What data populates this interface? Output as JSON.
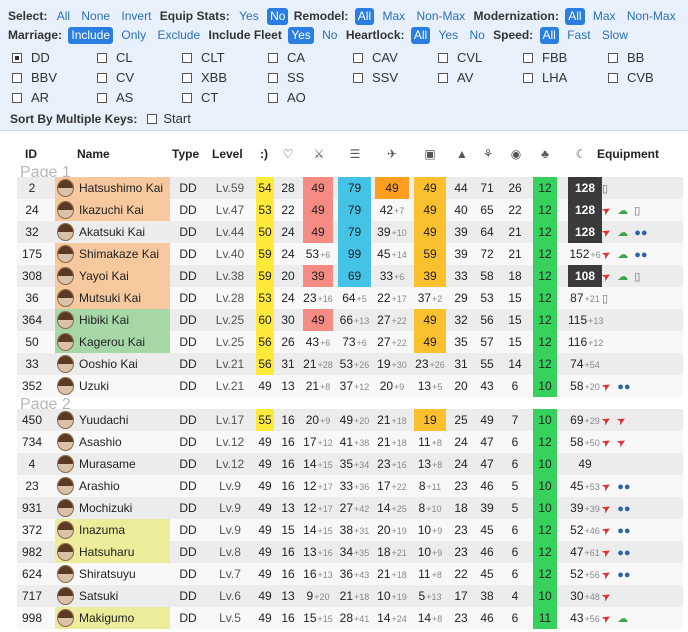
{
  "colors": {
    "yellow": "#ffe93b",
    "salmon": "#f58b83",
    "cyan": "#44c3e6",
    "orange": "#ff9e1f",
    "gold": "#fbc02d",
    "green": "#37d15d",
    "dark": "#3a3a3a",
    "name_orange": "#f6c89d",
    "name_green": "#a7d7a7",
    "name_yellow": "#ecec9a",
    "accent": "#2a7de1"
  },
  "filters": {
    "select": {
      "label": "Select:",
      "options": [
        "All",
        "None",
        "Invert"
      ]
    },
    "equip": {
      "label": "Equip Stats:",
      "options": [
        "Yes",
        "No"
      ],
      "selected": 1
    },
    "remodel": {
      "label": "Remodel:",
      "options": [
        "All",
        "Max",
        "Non-Max"
      ],
      "selected": 0
    },
    "modernization": {
      "label": "Modernization:",
      "options": [
        "All",
        "Max",
        "Non-Max"
      ],
      "selected": 0
    },
    "marriage": {
      "label": "Marriage:",
      "options": [
        "Include",
        "Only",
        "Exclude"
      ],
      "selected": 0
    },
    "fleet": {
      "label": "Include Fleet",
      "options": [
        "Yes",
        "No"
      ],
      "selected": 0
    },
    "heartlock": {
      "label": "Heartlock:",
      "options": [
        "All",
        "Yes",
        "No"
      ],
      "selected": 0
    },
    "speed": {
      "label": "Speed:",
      "options": [
        "All",
        "Fast",
        "Slow"
      ],
      "selected": 0
    }
  },
  "types": [
    {
      "label": "DD",
      "checked": true
    },
    {
      "label": "CL",
      "checked": false
    },
    {
      "label": "CLT",
      "checked": false
    },
    {
      "label": "CA",
      "checked": false
    },
    {
      "label": "CAV",
      "checked": false
    },
    {
      "label": "CVL",
      "checked": false
    },
    {
      "label": "FBB",
      "checked": false
    },
    {
      "label": "BB",
      "checked": false
    },
    {
      "label": "BBV",
      "checked": false
    },
    {
      "label": "CV",
      "checked": false
    },
    {
      "label": "XBB",
      "checked": false
    },
    {
      "label": "SS",
      "checked": false
    },
    {
      "label": "SSV",
      "checked": false
    },
    {
      "label": "AV",
      "checked": false
    },
    {
      "label": "LHA",
      "checked": false
    },
    {
      "label": "CVB",
      "checked": false
    },
    {
      "label": "AR",
      "checked": false
    },
    {
      "label": "AS",
      "checked": false
    },
    {
      "label": "CT",
      "checked": false
    },
    {
      "label": "AO",
      "checked": false
    }
  ],
  "sort": {
    "label": "Sort By Multiple Keys:",
    "start": "Start"
  },
  "table": {
    "headers": {
      "id": "ID",
      "name": "Name",
      "type": "Type",
      "level": "Level",
      "morale": ":)",
      "equipment": "Equipment"
    },
    "stat_icons": [
      "heart-icon",
      "firepower-icon",
      "torpedo-icon",
      "anti-air-icon",
      "armor-icon",
      "evasion-icon",
      "asw-icon",
      "los-icon",
      "luck-icon",
      "lock-icon"
    ],
    "pages": [
      "Page 1",
      "Page 2"
    ],
    "rows": [
      {
        "id": "2",
        "name": "Hatsushimo Kai",
        "nb": "name_orange",
        "type": "DD",
        "lv": "Lv.59",
        "mo": "54",
        "mob": "yellow",
        "hp": "28",
        "fp": "49",
        "fpb": "salmon",
        "fps": "",
        "tp": "79",
        "tpb": "cyan",
        "tps": "",
        "aa": "49",
        "aab": "orange",
        "aas": "",
        "ar": "49",
        "arb": "gold",
        "ars": "",
        "ev": "44",
        "as": "71",
        "lo": "26",
        "lk": "12",
        "lu": "128",
        "lub": "dark",
        "lus": "",
        "eq": [
          "tube"
        ]
      },
      {
        "id": "24",
        "name": "Ikazuchi Kai",
        "nb": "name_orange",
        "type": "DD",
        "lv": "Lv.47",
        "mo": "53",
        "mob": "yellow",
        "hp": "22",
        "fp": "49",
        "fpb": "salmon",
        "fps": "",
        "tp": "79",
        "tpb": "cyan",
        "tps": "",
        "aa": "42",
        "aab": "",
        "aas": "+7",
        "ar": "49",
        "arb": "gold",
        "ars": "",
        "ev": "40",
        "as": "65",
        "lo": "22",
        "lk": "12",
        "lu": "128",
        "lub": "dark",
        "lus": "",
        "eq": [
          "gun",
          "radar",
          "tube"
        ]
      },
      {
        "id": "32",
        "name": "Akatsuki Kai",
        "nb": "",
        "type": "DD",
        "lv": "Lv.44",
        "mo": "50",
        "mob": "yellow",
        "hp": "24",
        "fp": "49",
        "fpb": "salmon",
        "fps": "",
        "tp": "79",
        "tpb": "cyan",
        "tps": "",
        "aa": "39",
        "aab": "",
        "aas": "+10",
        "ar": "49",
        "arb": "gold",
        "ars": "",
        "ev": "39",
        "as": "64",
        "lo": "21",
        "lk": "12",
        "lu": "128",
        "lub": "dark",
        "lus": "",
        "eq": [
          "gun",
          "radar",
          "bomb"
        ]
      },
      {
        "id": "175",
        "name": "Shimakaze Kai",
        "nb": "name_orange",
        "type": "DD",
        "lv": "Lv.40",
        "mo": "59",
        "mob": "yellow",
        "hp": "24",
        "fp": "53",
        "fpb": "",
        "fps": "+6",
        "tp": "99",
        "tpb": "cyan",
        "tps": "",
        "aa": "45",
        "aab": "",
        "aas": "+14",
        "ar": "59",
        "arb": "gold",
        "ars": "",
        "ev": "39",
        "as": "72",
        "lo": "21",
        "lk": "12",
        "lu": "152",
        "lub": "",
        "lus": "+6",
        "eq": [
          "gun",
          "radar",
          "bomb"
        ]
      },
      {
        "id": "308",
        "name": "Yayoi Kai",
        "nb": "name_orange",
        "type": "DD",
        "lv": "Lv.38",
        "mo": "59",
        "mob": "yellow",
        "hp": "20",
        "fp": "39",
        "fpb": "salmon",
        "fps": "",
        "tp": "69",
        "tpb": "cyan",
        "tps": "",
        "aa": "33",
        "aab": "",
        "aas": "+6",
        "ar": "39",
        "arb": "gold",
        "ars": "",
        "ev": "33",
        "as": "58",
        "lo": "18",
        "lk": "12",
        "lu": "108",
        "lub": "dark",
        "lus": "",
        "eq": [
          "gun",
          "radar",
          "tube"
        ]
      },
      {
        "id": "36",
        "name": "Mutsuki Kai",
        "nb": "name_orange",
        "type": "DD",
        "lv": "Lv.28",
        "mo": "53",
        "mob": "yellow",
        "hp": "24",
        "fp": "23",
        "fpb": "",
        "fps": "+16",
        "tp": "64",
        "tpb": "",
        "tps": "+5",
        "aa": "22",
        "aab": "",
        "aas": "+17",
        "ar": "37",
        "arb": "",
        "ars": "+2",
        "ev": "29",
        "as": "53",
        "lo": "15",
        "lk": "12",
        "lu": "87",
        "lub": "",
        "lus": "+21",
        "eq": [
          "tube"
        ]
      },
      {
        "id": "364",
        "name": "Hibiki Kai",
        "nb": "name_green",
        "type": "DD",
        "lv": "Lv.25",
        "mo": "60",
        "mob": "yellow",
        "hp": "30",
        "fp": "49",
        "fpb": "salmon",
        "fps": "",
        "tp": "66",
        "tpb": "",
        "tps": "+13",
        "aa": "27",
        "aab": "",
        "aas": "+22",
        "ar": "49",
        "arb": "gold",
        "ars": "",
        "ev": "32",
        "as": "56",
        "lo": "15",
        "lk": "12",
        "lu": "115",
        "lub": "",
        "lus": "+13",
        "eq": []
      },
      {
        "id": "50",
        "name": "Kagerou Kai",
        "nb": "name_green",
        "type": "DD",
        "lv": "Lv.25",
        "mo": "56",
        "mob": "yellow",
        "hp": "26",
        "fp": "43",
        "fpb": "",
        "fps": "+6",
        "tp": "73",
        "tpb": "",
        "tps": "+6",
        "aa": "27",
        "aab": "",
        "aas": "+22",
        "ar": "49",
        "arb": "gold",
        "ars": "",
        "ev": "35",
        "as": "57",
        "lo": "15",
        "lk": "12",
        "lu": "116",
        "lub": "",
        "lus": "+12",
        "eq": []
      },
      {
        "id": "33",
        "name": "Ooshio Kai",
        "nb": "",
        "type": "DD",
        "lv": "Lv.21",
        "mo": "56",
        "mob": "yellow",
        "hp": "31",
        "fp": "21",
        "fpb": "",
        "fps": "+28",
        "tp": "53",
        "tpb": "",
        "tps": "+26",
        "aa": "19",
        "aab": "",
        "aas": "+30",
        "ar": "23",
        "arb": "",
        "ars": "+26",
        "ev": "31",
        "as": "55",
        "lo": "14",
        "lk": "12",
        "lu": "74",
        "lub": "",
        "lus": "+54",
        "eq": []
      },
      {
        "id": "352",
        "name": "Uzuki",
        "nb": "",
        "type": "DD",
        "lv": "Lv.21",
        "mo": "49",
        "mob": "",
        "hp": "13",
        "fp": "21",
        "fpb": "",
        "fps": "+8",
        "tp": "37",
        "tpb": "",
        "tps": "+12",
        "aa": "20",
        "aab": "",
        "aas": "+9",
        "ar": "13",
        "arb": "",
        "ars": "+5",
        "ev": "20",
        "as": "43",
        "lo": "6",
        "lk": "10",
        "lu": "58",
        "lub": "",
        "lus": "+20",
        "eq": [
          "gun",
          "bomb"
        ]
      },
      {
        "id": "450",
        "name": "Yuudachi",
        "nb": "",
        "type": "DD",
        "lv": "Lv.17",
        "mo": "55",
        "mob": "yellow",
        "hp": "16",
        "fp": "20",
        "fpb": "",
        "fps": "+9",
        "tp": "49",
        "tpb": "",
        "tps": "+20",
        "aa": "21",
        "aab": "",
        "aas": "+18",
        "ar": "19",
        "arb": "gold",
        "ars": "",
        "ev": "25",
        "as": "49",
        "lo": "7",
        "lk": "10",
        "lu": "69",
        "lub": "",
        "lus": "+29",
        "eq": [
          "gun",
          "gun"
        ]
      },
      {
        "id": "734",
        "name": "Asashio",
        "nb": "",
        "type": "DD",
        "lv": "Lv.12",
        "mo": "49",
        "mob": "",
        "hp": "16",
        "fp": "17",
        "fpb": "",
        "fps": "+12",
        "tp": "41",
        "tpb": "",
        "tps": "+38",
        "aa": "21",
        "aab": "",
        "aas": "+18",
        "ar": "11",
        "arb": "",
        "ars": "+8",
        "ev": "24",
        "as": "47",
        "lo": "6",
        "lk": "12",
        "lu": "58",
        "lub": "",
        "lus": "+50",
        "eq": [
          "gun",
          "gun"
        ]
      },
      {
        "id": "4",
        "name": "Murasame",
        "nb": "",
        "type": "DD",
        "lv": "Lv.12",
        "mo": "49",
        "mob": "",
        "hp": "16",
        "fp": "14",
        "fpb": "",
        "fps": "+15",
        "tp": "35",
        "tpb": "",
        "tps": "+34",
        "aa": "23",
        "aab": "",
        "aas": "+16",
        "ar": "13",
        "arb": "",
        "ars": "+8",
        "ev": "24",
        "as": "47",
        "lo": "6",
        "lk": "10",
        "lu": "49",
        "lub": "",
        "lus": "",
        "eq": []
      },
      {
        "id": "23",
        "name": "Arashio",
        "nb": "",
        "type": "DD",
        "lv": "Lv.9",
        "mo": "49",
        "mob": "",
        "hp": "16",
        "fp": "12",
        "fpb": "",
        "fps": "+17",
        "tp": "33",
        "tpb": "",
        "tps": "+36",
        "aa": "17",
        "aab": "",
        "aas": "+22",
        "ar": "8",
        "arb": "",
        "ars": "+11",
        "ev": "23",
        "as": "46",
        "lo": "5",
        "lk": "10",
        "lu": "45",
        "lub": "",
        "lus": "+53",
        "eq": [
          "gun",
          "bomb"
        ]
      },
      {
        "id": "931",
        "name": "Mochizuki",
        "nb": "",
        "type": "DD",
        "lv": "Lv.9",
        "mo": "49",
        "mob": "",
        "hp": "13",
        "fp": "12",
        "fpb": "",
        "fps": "+17",
        "tp": "27",
        "tpb": "",
        "tps": "+42",
        "aa": "14",
        "aab": "",
        "aas": "+25",
        "ar": "8",
        "arb": "",
        "ars": "+10",
        "ev": "18",
        "as": "39",
        "lo": "5",
        "lk": "10",
        "lu": "39",
        "lub": "",
        "lus": "+39",
        "eq": [
          "gun",
          "bomb"
        ]
      },
      {
        "id": "372",
        "name": "Inazuma",
        "nb": "name_yellow",
        "type": "DD",
        "lv": "Lv.9",
        "mo": "49",
        "mob": "",
        "hp": "15",
        "fp": "14",
        "fpb": "",
        "fps": "+15",
        "tp": "38",
        "tpb": "",
        "tps": "+31",
        "aa": "20",
        "aab": "",
        "aas": "+19",
        "ar": "10",
        "arb": "",
        "ars": "+9",
        "ev": "23",
        "as": "45",
        "lo": "6",
        "lk": "12",
        "lu": "52",
        "lub": "",
        "lus": "+46",
        "eq": [
          "gun",
          "bomb"
        ]
      },
      {
        "id": "982",
        "name": "Hatsuharu",
        "nb": "name_yellow",
        "type": "DD",
        "lv": "Lv.8",
        "mo": "49",
        "mob": "",
        "hp": "16",
        "fp": "13",
        "fpb": "",
        "fps": "+16",
        "tp": "34",
        "tpb": "",
        "tps": "+35",
        "aa": "18",
        "aab": "",
        "aas": "+21",
        "ar": "10",
        "arb": "",
        "ars": "+9",
        "ev": "23",
        "as": "46",
        "lo": "6",
        "lk": "12",
        "lu": "47",
        "lub": "",
        "lus": "+61",
        "eq": [
          "gun",
          "bomb"
        ]
      },
      {
        "id": "624",
        "name": "Shiratsuyu",
        "nb": "",
        "type": "DD",
        "lv": "Lv.7",
        "mo": "49",
        "mob": "",
        "hp": "16",
        "fp": "16",
        "fpb": "",
        "fps": "+13",
        "tp": "36",
        "tpb": "",
        "tps": "+43",
        "aa": "21",
        "aab": "",
        "aas": "+18",
        "ar": "11",
        "arb": "",
        "ars": "+8",
        "ev": "22",
        "as": "45",
        "lo": "6",
        "lk": "12",
        "lu": "52",
        "lub": "",
        "lus": "+56",
        "eq": [
          "gun",
          "bomb"
        ]
      },
      {
        "id": "717",
        "name": "Satsuki",
        "nb": "",
        "type": "DD",
        "lv": "Lv.6",
        "mo": "49",
        "mob": "",
        "hp": "13",
        "fp": "9",
        "fpb": "",
        "fps": "+20",
        "tp": "21",
        "tpb": "",
        "tps": "+18",
        "aa": "10",
        "aab": "",
        "aas": "+19",
        "ar": "5",
        "arb": "",
        "ars": "+13",
        "ev": "17",
        "as": "38",
        "lo": "4",
        "lk": "10",
        "lu": "30",
        "lub": "",
        "lus": "+48",
        "eq": [
          "gun"
        ]
      },
      {
        "id": "998",
        "name": "Makigumo",
        "nb": "name_yellow",
        "type": "DD",
        "lv": "Lv.5",
        "mo": "49",
        "mob": "",
        "hp": "16",
        "fp": "15",
        "fpb": "",
        "fps": "+15",
        "tp": "28",
        "tpb": "",
        "tps": "+41",
        "aa": "14",
        "aab": "",
        "aas": "+24",
        "ar": "14",
        "arb": "",
        "ars": "+8",
        "ev": "23",
        "as": "46",
        "lo": "6",
        "lk": "11",
        "lu": "43",
        "lub": "",
        "lus": "+56",
        "eq": [
          "gun",
          "radar"
        ]
      }
    ]
  }
}
